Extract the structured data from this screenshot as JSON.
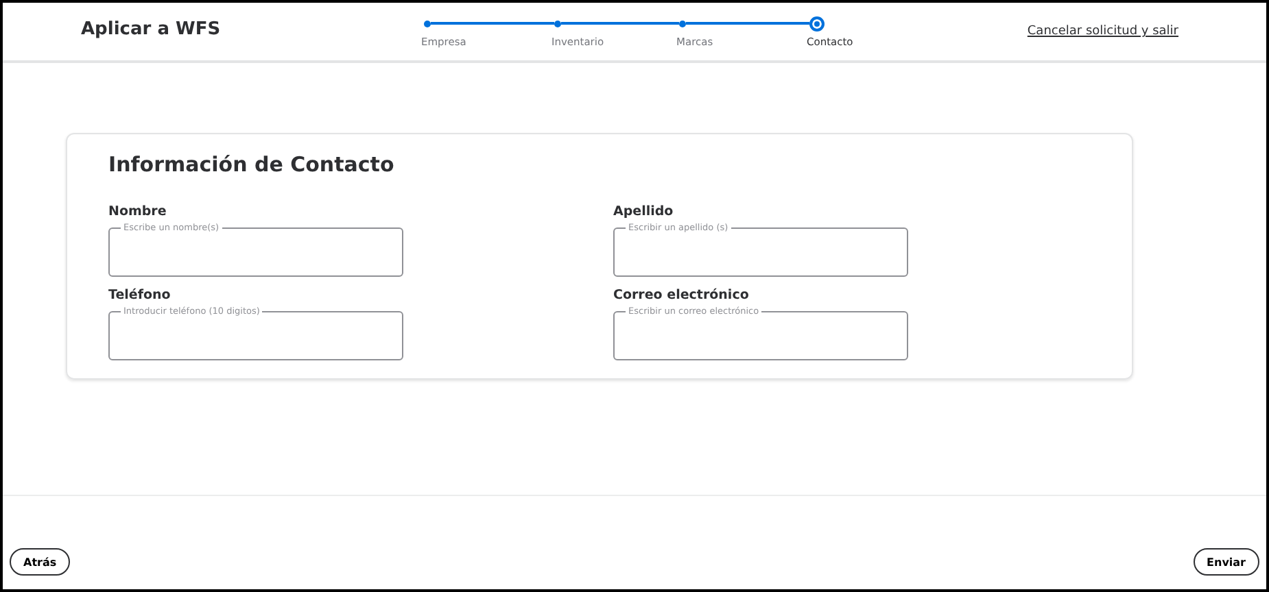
{
  "header": {
    "title": "Aplicar a WFS",
    "cancel_link": "Cancelar solicitud y salir"
  },
  "steps": [
    {
      "label": "Empresa",
      "selected": false
    },
    {
      "label": "Inventario",
      "selected": false
    },
    {
      "label": "Marcas",
      "selected": false
    },
    {
      "label": "Contacto",
      "selected": true
    }
  ],
  "form": {
    "title": "Información de Contacto",
    "fields": [
      {
        "label": "Nombre",
        "placeholder": "Escribe un nombre(s)"
      },
      {
        "label": "Apellido",
        "placeholder": "Escribir un apellido (s)"
      },
      {
        "label": "Teléfono",
        "placeholder": "Introducir teléfono (10 digitos)"
      },
      {
        "label": "Correo electrónico",
        "placeholder": "Escribir un correo electrónico"
      }
    ]
  },
  "footer": {
    "back_button": "Atrás",
    "submit_button": "Enviar"
  }
}
